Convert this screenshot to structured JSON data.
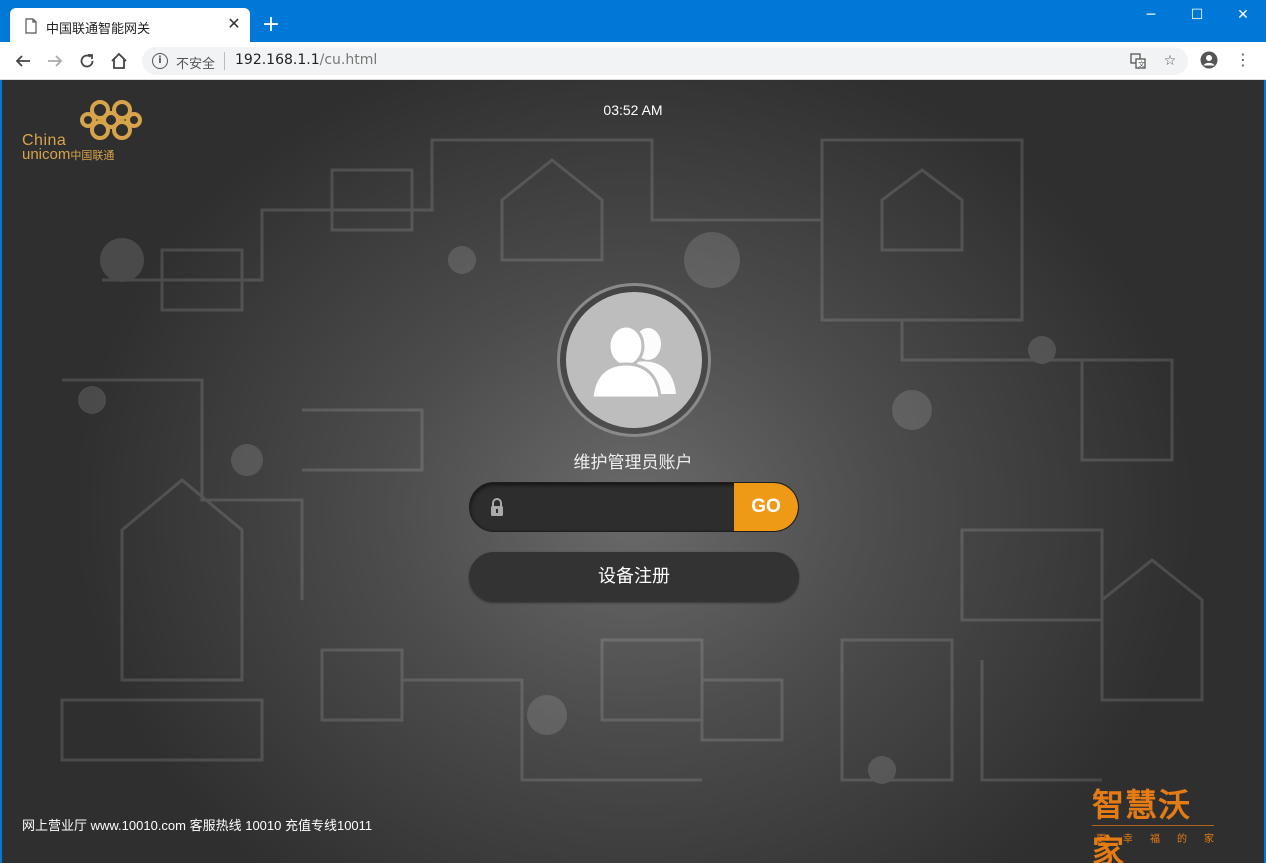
{
  "browser": {
    "tab": {
      "title": "中国联通智能网关",
      "close_icon": "close-icon",
      "page_icon": "document-icon"
    },
    "new_tab_icon": "plus-icon",
    "window_controls": {
      "minimize": "minimize-icon",
      "maximize": "maximize-icon",
      "close": "close-icon"
    },
    "nav": {
      "back": "back-arrow-icon",
      "forward": "forward-arrow-icon",
      "reload": "reload-icon",
      "home": "home-icon"
    },
    "omnibox": {
      "security_icon": "info-icon",
      "security_label": "不安全",
      "url_host": "192.168.1.1",
      "url_path": "/cu.html",
      "translate_icon": "translate-icon",
      "bookmark_icon": "star-icon"
    },
    "toolbar_right": {
      "profile_icon": "account-circle-icon",
      "menu_icon": "more-vert-icon"
    }
  },
  "page": {
    "logo": {
      "line1": "China",
      "line2": "unicom",
      "line2_cn": "中国联通"
    },
    "clock": "03:52 AM",
    "account_label": "维护管理员账户",
    "password": {
      "value": "",
      "placeholder": ""
    },
    "go_label": "GO",
    "register_label": "设备注册",
    "footer": "网上营业厅 www.10010.com 客服热线 10010 充值专线10011",
    "brand": {
      "main": "智慧沃家",
      "sub": "更幸福的家"
    }
  },
  "colors": {
    "chrome_blue": "#0078d7",
    "accent_orange": "#ef9a17",
    "brand_orange": "#e57b14",
    "logo_gold": "#d8a44a"
  }
}
